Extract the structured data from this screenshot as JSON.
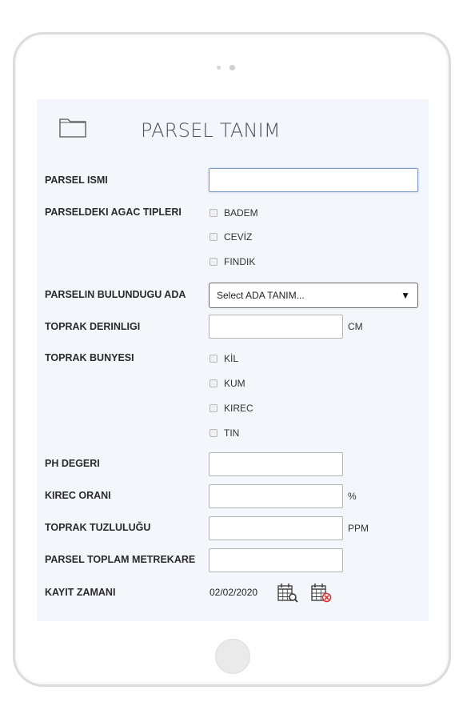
{
  "header": {
    "title": "PARSEL TANIM",
    "icon": "folder-icon"
  },
  "form": {
    "parsel_ismi": {
      "label": "PARSEL ISMI",
      "value": ""
    },
    "agac_tipleri": {
      "label": "PARSELDEKI AGAC TIPLERI",
      "options": [
        "BADEM",
        "CEVİZ",
        "FINDIK"
      ]
    },
    "ada": {
      "label": "PARSELIN BULUNDUGU ADA",
      "selected": "Select ADA TANIM...",
      "arrow": "▼"
    },
    "toprak_derinligi": {
      "label": "TOPRAK DERINLIGI",
      "value": "",
      "unit": "CM"
    },
    "toprak_bunyesi": {
      "label": "TOPRAK BUNYESI",
      "options": [
        "KİL",
        "KUM",
        "KIREC",
        "TIN"
      ]
    },
    "ph_degeri": {
      "label": "PH DEGERI",
      "value": ""
    },
    "kirec_orani": {
      "label": "KIREC ORANI",
      "value": "",
      "unit": "%"
    },
    "toprak_tuzlulugu": {
      "label": "TOPRAK TUZLULUĞU",
      "value": "",
      "unit": "PPM"
    },
    "toplam_metrekare": {
      "label": "PARSEL TOPLAM METREKARE",
      "value": ""
    },
    "kayit_zamani": {
      "label": "KAYIT ZAMANI",
      "value": "02/02/2020"
    }
  },
  "icons": {
    "calendar_search": "calendar-search-icon",
    "calendar_clear": "calendar-clear-icon"
  },
  "colors": {
    "screen_bg": "#f3f6fa",
    "focus_border": "#7a9bc9",
    "clear_red": "#e03030"
  }
}
